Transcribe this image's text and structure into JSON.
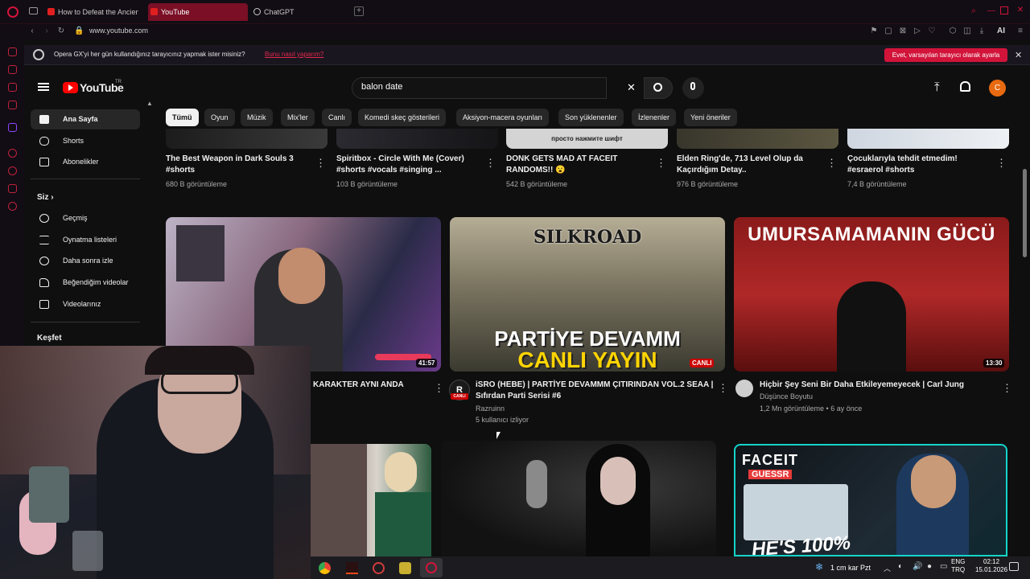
{
  "browser": {
    "tabs": [
      {
        "label": "How to Defeat the Ancient"
      },
      {
        "label": "YouTube"
      },
      {
        "label": "ChatGPT"
      }
    ],
    "url": "www.youtube.com",
    "notice": {
      "text": "Opera GX'yi her gün kullandığınız tarayıcınız yapmak ister misiniz?",
      "link": "Bunu nasıl yaparım?",
      "button": "Evet, varsayılan tarayıcı olarak ayarla",
      "close": "✕"
    },
    "ai_label": "AI"
  },
  "youtube": {
    "logo": "YouTube",
    "logo_sup": "TR",
    "search": {
      "value": "balon date",
      "clear": "✕"
    },
    "avatar": "C",
    "sidebar": [
      {
        "label": "Ana Sayfa"
      },
      {
        "label": "Shorts"
      },
      {
        "label": "Abonelikler"
      }
    ],
    "you_header": "Siz",
    "you_items": [
      {
        "label": "Geçmiş"
      },
      {
        "label": "Oynatma listeleri"
      },
      {
        "label": "Daha sonra izle"
      },
      {
        "label": "Beğendiğim videolar"
      },
      {
        "label": "Videolarınız"
      }
    ],
    "explore": "Keşfet",
    "chips": [
      "Tümü",
      "Oyun",
      "Müzik",
      "Mix'ler",
      "Canlı",
      "Komedi skeç gösterileri",
      "Aksiyon-macera oyunları",
      "Son yüklenenler",
      "İzlenenler",
      "Yeni öneriler"
    ],
    "shorts": [
      {
        "title1": "The Best Weapon in Dark Souls 3",
        "title2": "#shorts",
        "views": "680 B görüntüleme"
      },
      {
        "title1": "Spiritbox - Circle With Me (Cover)",
        "title2": "#shorts #vocals #singing ...",
        "views": "103 B görüntüleme"
      },
      {
        "title1": "DONK GETS MAD AT FACEIT",
        "title2": "RANDOMS!! 😮",
        "views": "542 B görüntüleme",
        "overlay": "просто нажмите шифт"
      },
      {
        "title1": "Elden Ring'de, 713 Level Olup da",
        "title2": "Kaçırdığım Detay..",
        "views": "976 B görüntüleme"
      },
      {
        "title1": "Çocuklarıyla tehdit etmedim!",
        "title2": "#esraerol #shorts",
        "views": "7,4 B görüntüleme"
      }
    ],
    "videos": [
      {
        "title": "KARAKTER AYNI ANDA",
        "duration": "41:57"
      },
      {
        "title1": "iSRO (HEBE) | PARTİYE DEVAMMM ÇITIRINDAN VOL.2 SEAA |",
        "title2": "Sıfırdan Parti Serisi #6",
        "channel": "Razruinn",
        "meta": "5 kullanıcı izliyor",
        "badge": "CANLI",
        "thumb_top": "SILKROAD",
        "thumb_line1": "PARTİYE DEVAMM",
        "thumb_line2": "CANLI YAYIN",
        "avatar_letter": "R",
        "avatar_badge": "CANLI"
      },
      {
        "title": "Hiçbir Şey Seni Bir Daha Etkileyemeyecek | Carl Jung",
        "channel": "Düşünce Boyutu",
        "meta": "1,2 Mn görüntüleme • 6 ay önce",
        "duration": "13:30",
        "thumb_text": "UMURSAMAMANIN GÜCÜ"
      }
    ],
    "bottom_thumbs": {
      "faceit": "FACEIT",
      "guessr": "GUESSR",
      "hes": "HE'S 100%"
    }
  },
  "taskbar": {
    "weather": "1 cm kar Pzt",
    "lang1": "ENG",
    "lang2": "TRQ",
    "time": "02:12",
    "date": "15.01.2026"
  }
}
